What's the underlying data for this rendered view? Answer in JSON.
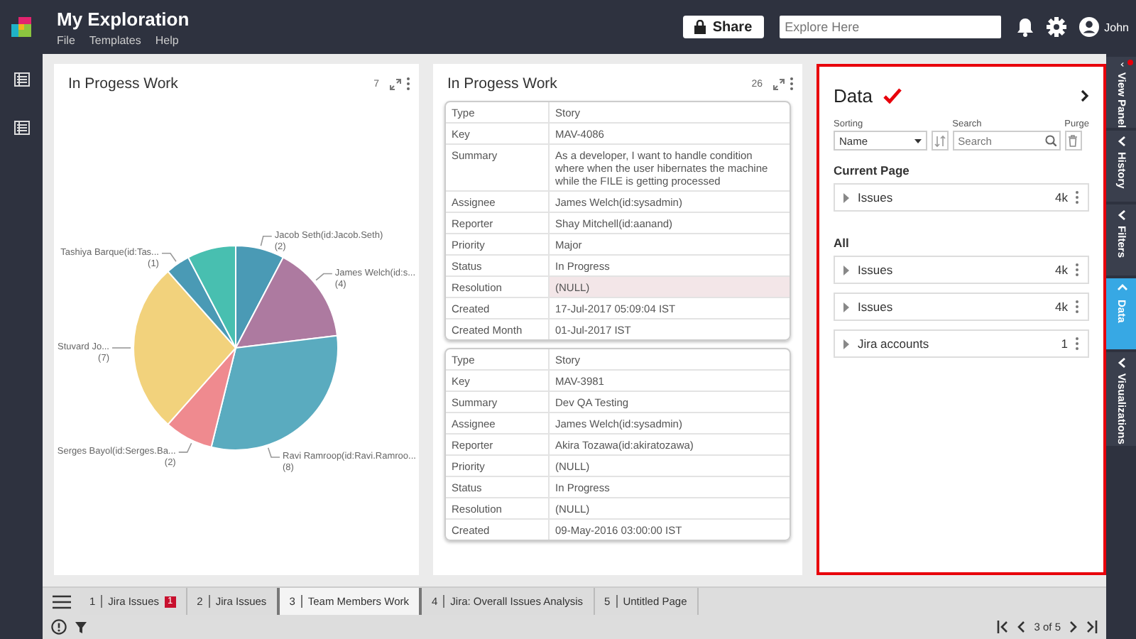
{
  "header": {
    "title": "My Exploration",
    "menu": [
      "File",
      "Templates",
      "Help"
    ],
    "share": "Share",
    "search_placeholder": "Explore Here",
    "user": "John"
  },
  "widgets": [
    {
      "kind": "chart",
      "title": "In Progess Work",
      "count": "7",
      "chart_data": {
        "type": "pie",
        "categories": [
          "Jacob Seth(id:Jacob.Seth)",
          "James Welch(id:s...",
          "Ravi Ramroop(id:Ravi.Ramroo...",
          "Serges Bayol(id:Serges.Ba...",
          "Stuvard Jo...",
          "Tashiya Barque(id:Tas...",
          null
        ],
        "values": [
          2,
          4,
          8,
          2,
          7,
          1,
          2
        ],
        "value_labels": [
          "(2)",
          "(4)",
          "(8)",
          "(2)",
          "(7)",
          "(1)",
          null
        ],
        "colors": [
          "#4a9ab5",
          "#ad7aa0",
          "#5aabbf",
          "#ef8a8f",
          "#f2d27c",
          "#4a9ab5",
          "#48bfb0"
        ]
      }
    },
    {
      "kind": "records",
      "title": "In Progess Work",
      "count": "26",
      "records": [
        {
          "fields": [
            {
              "label": "Type",
              "value": "Story",
              "highlighted": false
            },
            {
              "label": "Key",
              "value": "MAV-4086",
              "highlighted": false
            },
            {
              "label": "Summary",
              "value": "As a developer, I want to handle condition where when the user hibernates the machine while the FILE is getting processed",
              "highlighted": false
            },
            {
              "label": "Assignee",
              "value": "James Welch(id:sysadmin)",
              "highlighted": false
            },
            {
              "label": "Reporter",
              "value": "Shay Mitchell(id:aanand)",
              "highlighted": false
            },
            {
              "label": "Priority",
              "value": "Major",
              "highlighted": false
            },
            {
              "label": "Status",
              "value": "In Progress",
              "highlighted": false
            },
            {
              "label": "Resolution",
              "value": "(NULL)",
              "highlighted": true
            },
            {
              "label": "Created",
              "value": "17-Jul-2017 05:09:04 IST",
              "highlighted": false
            },
            {
              "label": "Created Month",
              "value": "01-Jul-2017 IST",
              "highlighted": false
            }
          ]
        },
        {
          "fields": [
            {
              "label": "Type",
              "value": "Story",
              "highlighted": false
            },
            {
              "label": "Key",
              "value": "MAV-3981",
              "highlighted": false
            },
            {
              "label": "Summary",
              "value": "Dev QA Testing",
              "highlighted": false
            },
            {
              "label": "Assignee",
              "value": "James Welch(id:sysadmin)",
              "highlighted": false
            },
            {
              "label": "Reporter",
              "value": "Akira Tozawa(id:akiratozawa)",
              "highlighted": false
            },
            {
              "label": "Priority",
              "value": "(NULL)",
              "highlighted": false
            },
            {
              "label": "Status",
              "value": "In Progress",
              "highlighted": false
            },
            {
              "label": "Resolution",
              "value": "(NULL)",
              "highlighted": false
            },
            {
              "label": "Created",
              "value": "09-May-2016 03:00:00 IST",
              "highlighted": false
            }
          ]
        }
      ]
    }
  ],
  "data_panel": {
    "title": "Data",
    "sorting_label": "Sorting",
    "sorting_value": "Name",
    "search_label": "Search",
    "search_placeholder": "Search",
    "purge_label": "Purge",
    "sections": [
      {
        "title": "Current Page",
        "items": [
          {
            "name": "Issues",
            "count": "4k"
          }
        ]
      },
      {
        "title": "All",
        "items": [
          {
            "name": "Issues",
            "count": "4k"
          },
          {
            "name": "Issues",
            "count": "4k"
          },
          {
            "name": "Jira accounts",
            "count": "1"
          }
        ]
      }
    ]
  },
  "side_tabs": [
    {
      "label": "View Panel",
      "selected": false,
      "notification": true
    },
    {
      "label": "History",
      "selected": false,
      "notification": false
    },
    {
      "label": "Filters",
      "selected": false,
      "notification": false
    },
    {
      "label": "Data",
      "selected": true,
      "notification": false
    },
    {
      "label": "Visualizations",
      "selected": false,
      "notification": false
    }
  ],
  "page_tabs": [
    {
      "number": "1",
      "label": "Jira Issues",
      "selected": false,
      "badge": "1"
    },
    {
      "number": "2",
      "label": "Jira Issues",
      "selected": false
    },
    {
      "number": "3",
      "label": "Team Members Work",
      "selected": true
    },
    {
      "number": "4",
      "label": "Jira: Overall Issues Analysis",
      "selected": false
    },
    {
      "number": "5",
      "label": "Untitled Page",
      "selected": false
    }
  ],
  "pager": "3 of 5"
}
